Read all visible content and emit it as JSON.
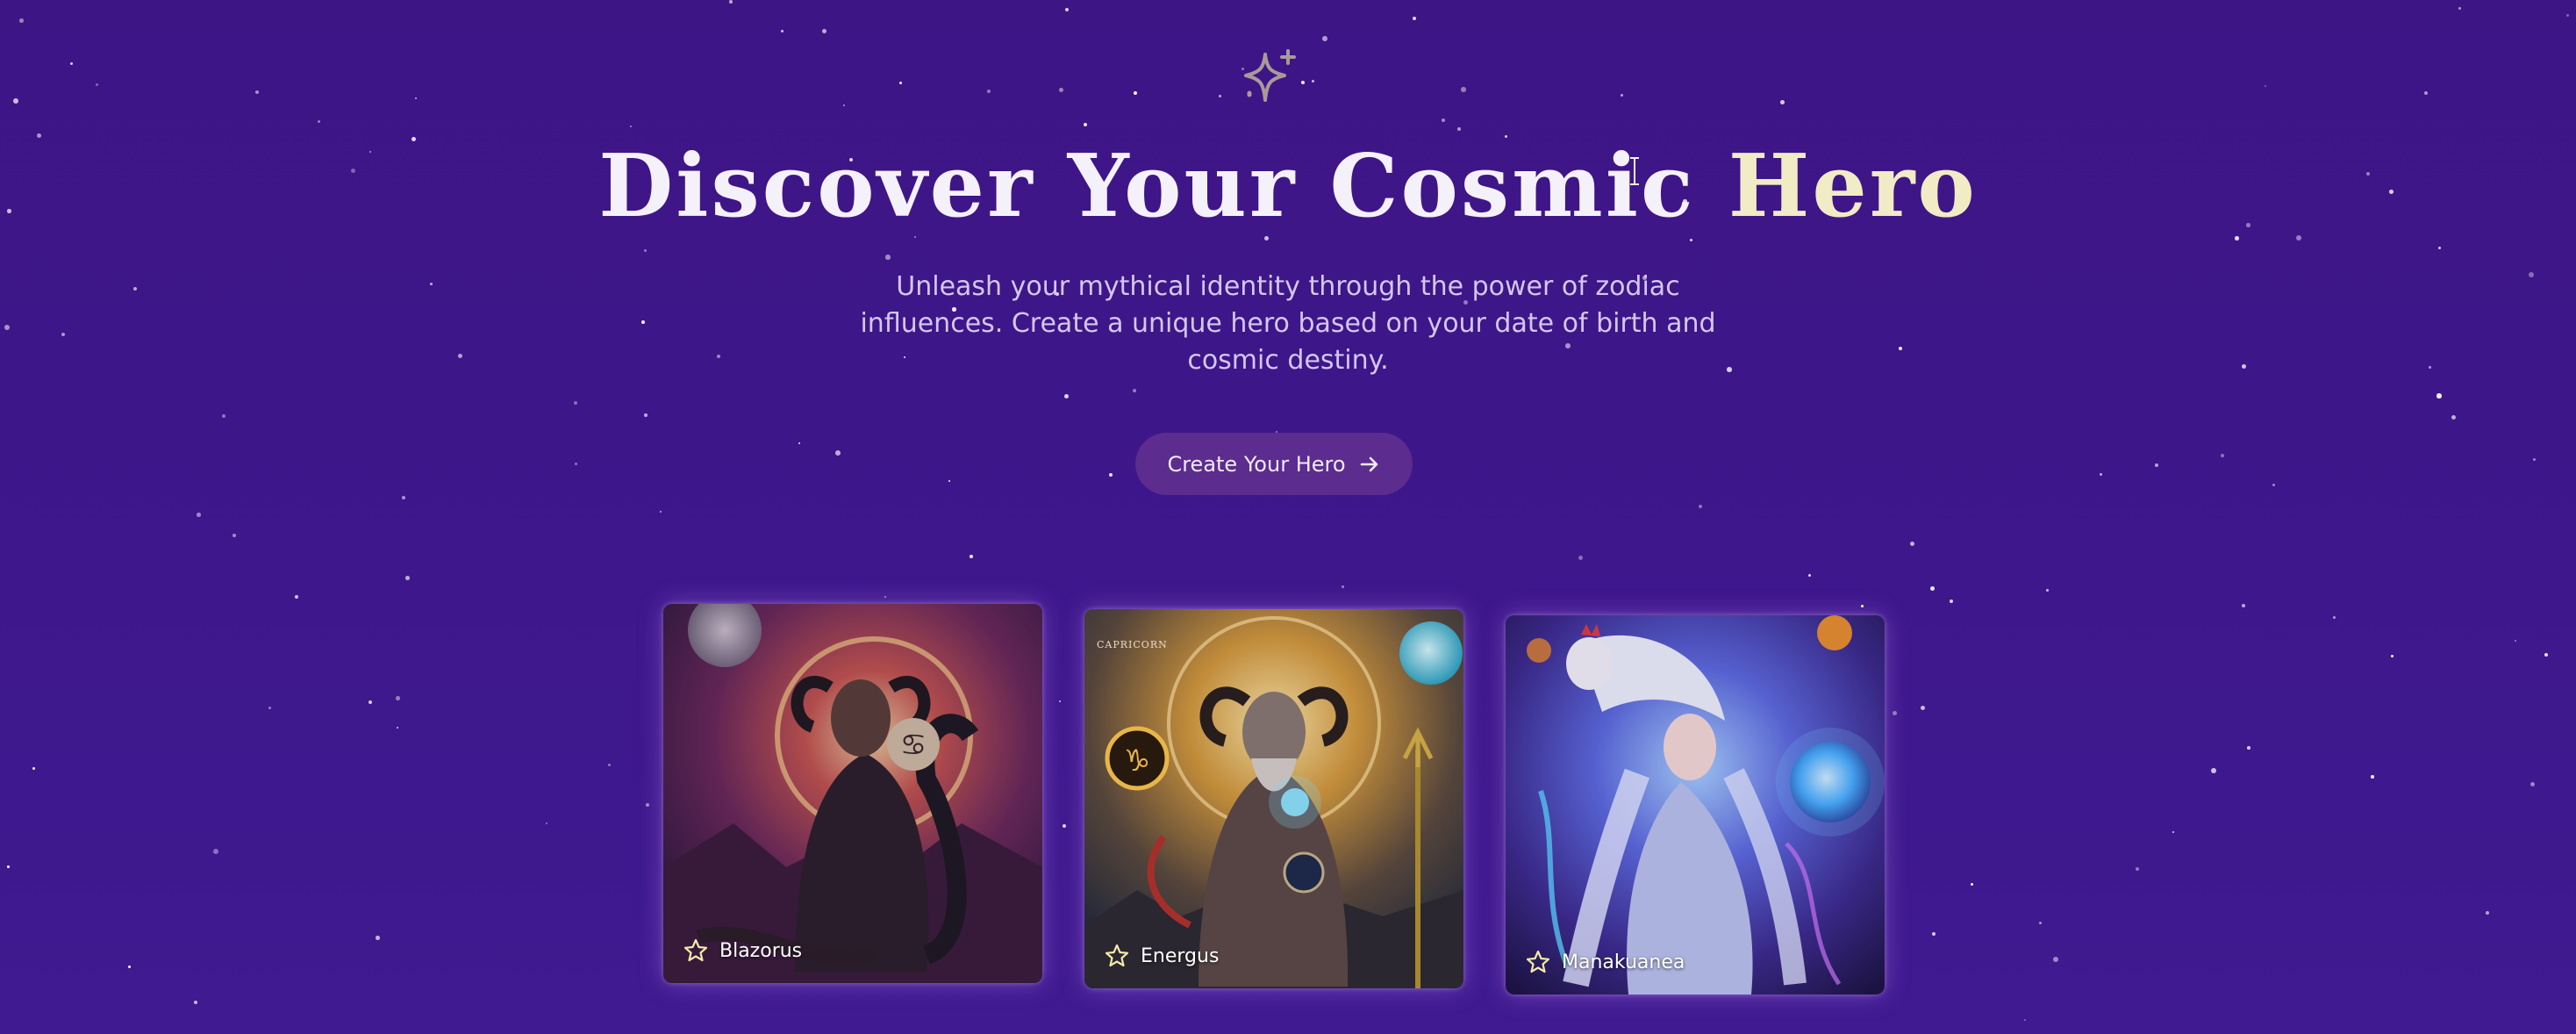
{
  "hero": {
    "title_main": "Discover Your Cosmic",
    "title_accent": "Hero",
    "subtitle": "Unleash your mythical identity through the power of zodiac influences. Create a unique hero based on your date of birth and cosmic destiny.",
    "cta_label": "Create Your Hero",
    "icons": {
      "top": "sparkle-icon",
      "cta": "arrow-right-icon"
    }
  },
  "cards": [
    {
      "name": "Blazorus",
      "icon": "star-icon"
    },
    {
      "name": "Energus",
      "icon": "star-icon",
      "image_text": "CAPRICORN"
    },
    {
      "name": "Manakuanea",
      "icon": "star-icon"
    }
  ],
  "colors": {
    "background": "#3d168a",
    "title": "#f5f1fb",
    "title_accent": "#f1ebc6",
    "subtitle": "#d4c6ee",
    "button": "#5c2c8f"
  }
}
